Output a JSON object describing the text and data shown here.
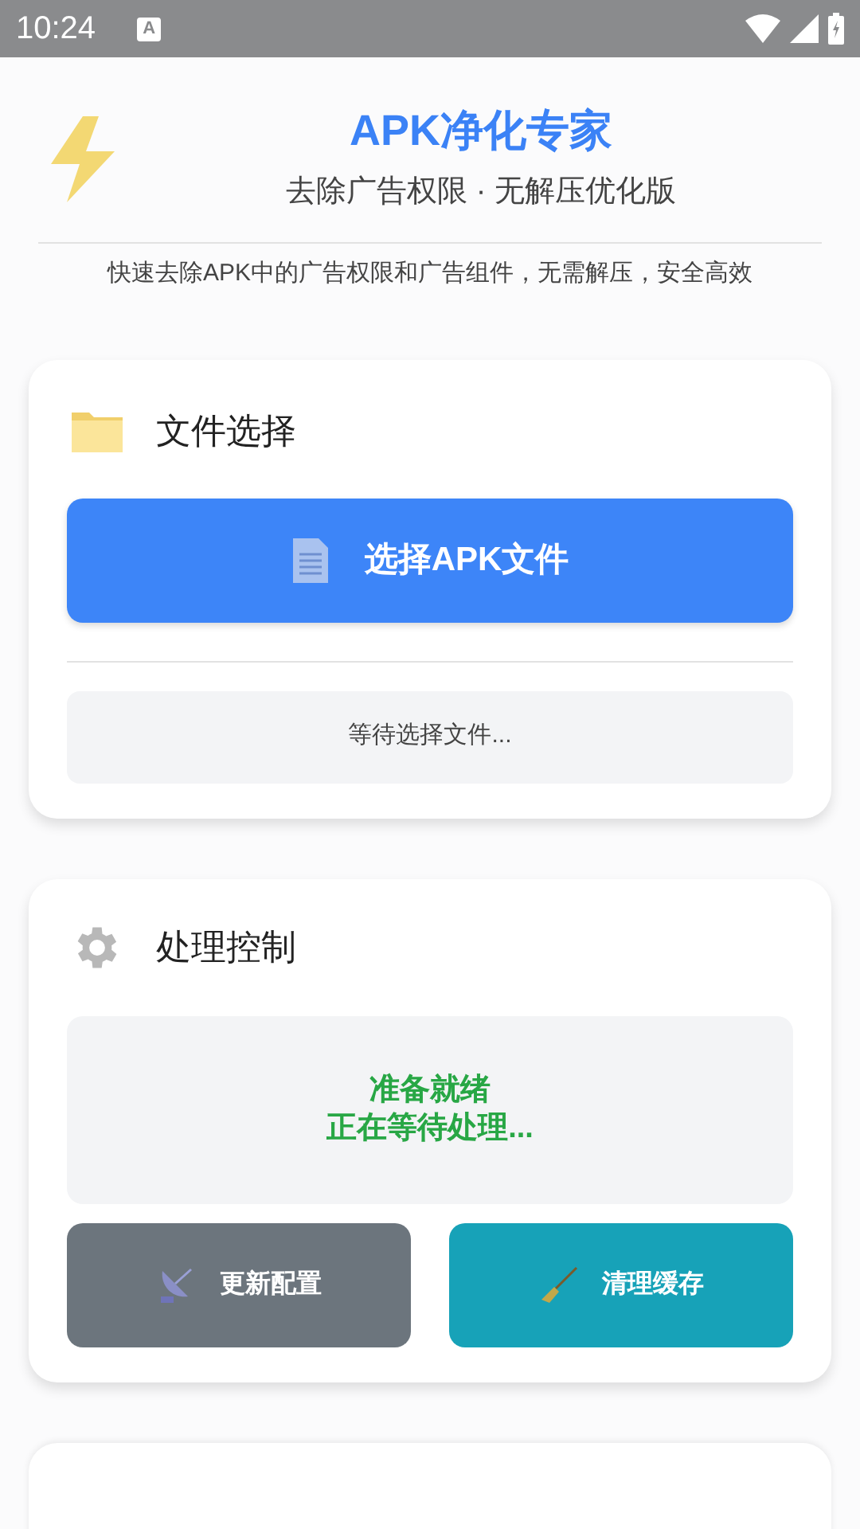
{
  "status_bar": {
    "time": "10:24",
    "notification_glyph": "A"
  },
  "header": {
    "title": "APK净化专家",
    "subtitle": "去除广告权限 · 无解压优化版",
    "description": "快速去除APK中的广告权限和广告组件，无需解压，安全高效"
  },
  "file_card": {
    "title": "文件选择",
    "button": "选择APK文件",
    "status": "等待选择文件..."
  },
  "control_card": {
    "title": "处理控制",
    "status_lines": [
      "准备就绪",
      "正在等待处理..."
    ],
    "buttons": [
      {
        "label": "更新配置",
        "kind": "update"
      },
      {
        "label": "清理缓存",
        "kind": "clean"
      }
    ]
  }
}
